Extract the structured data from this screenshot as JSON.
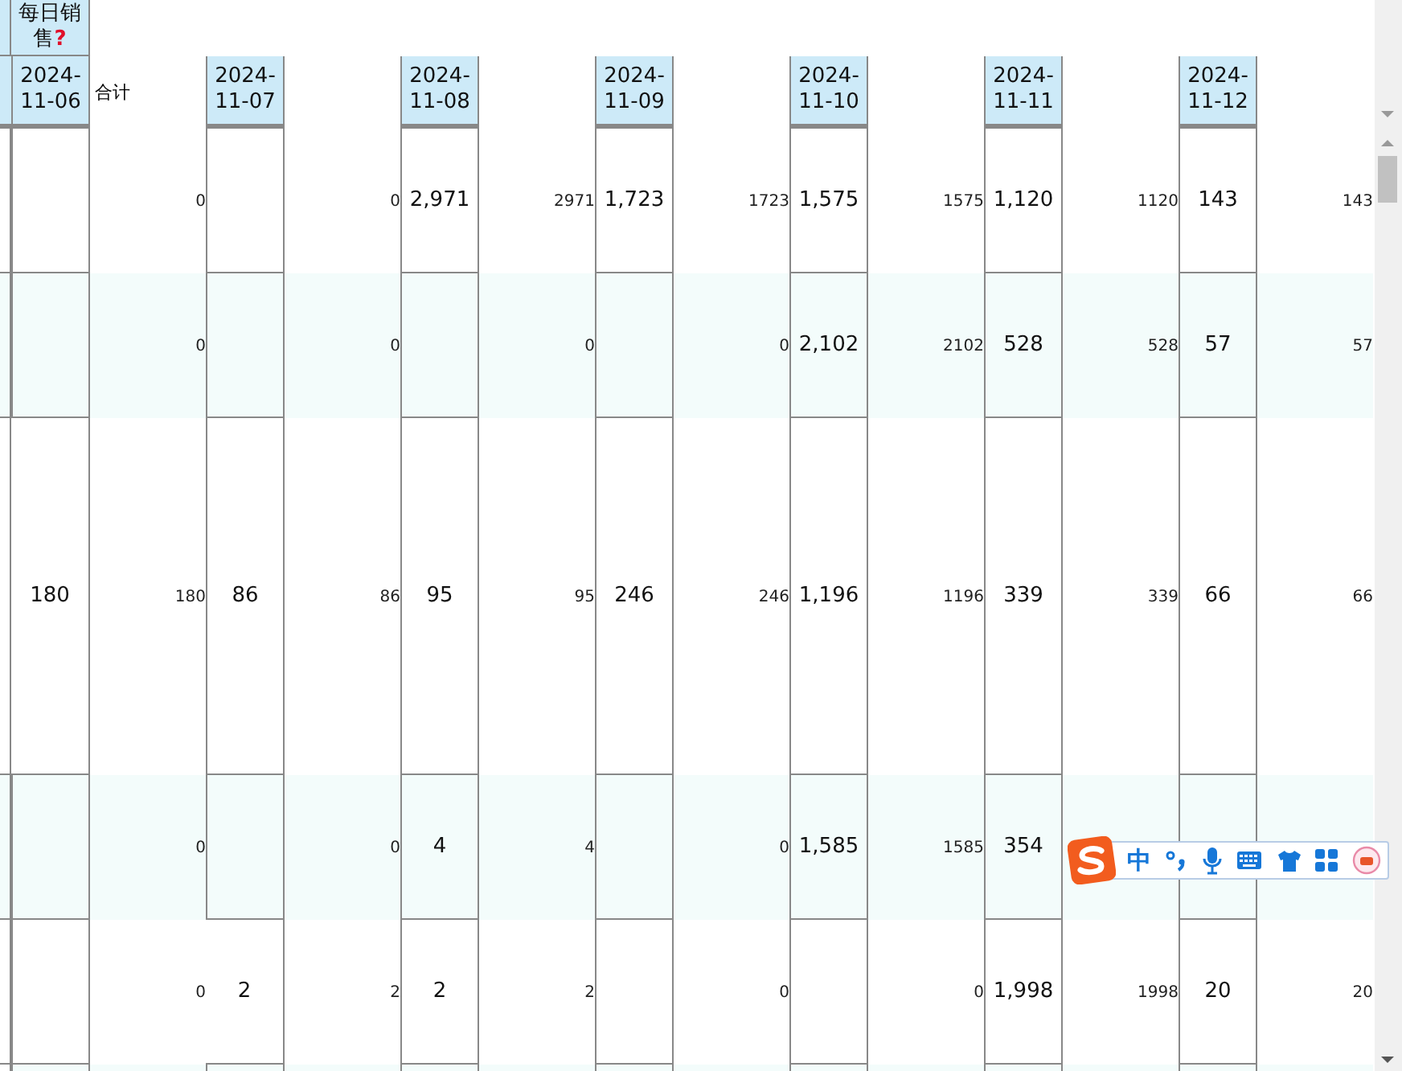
{
  "sheet": {
    "group_header": {
      "text": "每日销",
      "text2": "售",
      "flag": "?"
    },
    "sum_label": "合计",
    "dates": [
      "2024-11-06",
      "2024-11-07",
      "2024-11-08",
      "2024-11-09",
      "2024-11-10",
      "2024-11-11",
      "2024-11-12"
    ],
    "rows": [
      {
        "cells": [
          {
            "sum": "0"
          },
          {
            "sum": "0"
          },
          {
            "value": "2,971",
            "sum": "2971"
          },
          {
            "value": "1,723",
            "sum": "1723"
          },
          {
            "value": "1,575",
            "sum": "1575"
          },
          {
            "value": "1,120",
            "sum": "1120"
          },
          {
            "value": "143",
            "sum": "143"
          }
        ]
      },
      {
        "cells": [
          {
            "sum": "0"
          },
          {
            "sum": "0"
          },
          {
            "sum": "0"
          },
          {
            "sum": "0"
          },
          {
            "value": "2,102",
            "sum": "2102"
          },
          {
            "value": "528",
            "sum": "528"
          },
          {
            "value": "57",
            "sum": "57"
          }
        ]
      },
      {
        "cells": [
          {
            "value": "180",
            "sum": "180"
          },
          {
            "value": "86",
            "sum": "86"
          },
          {
            "value": "95",
            "sum": "95"
          },
          {
            "value": "246",
            "sum": "246"
          },
          {
            "value": "1,196",
            "sum": "1196"
          },
          {
            "value": "339",
            "sum": "339"
          },
          {
            "value": "66",
            "sum": "66"
          }
        ]
      },
      {
        "cells": [
          {
            "sum": "0"
          },
          {
            "sum": "0"
          },
          {
            "value": "4",
            "sum": "4"
          },
          {
            "sum": "0"
          },
          {
            "value": "1,585",
            "sum": "1585"
          },
          {
            "value": "354"
          },
          {}
        ]
      },
      {
        "cells": [
          {
            "sum": "0"
          },
          {
            "value": "2",
            "sum": "2"
          },
          {
            "value": "2",
            "sum": "2"
          },
          {
            "sum": "0"
          },
          {
            "sum": "0"
          },
          {
            "value": "1,998",
            "sum": "1998"
          },
          {
            "value": "20",
            "sum": "20"
          }
        ]
      }
    ]
  },
  "ime": {
    "mode": "中"
  }
}
